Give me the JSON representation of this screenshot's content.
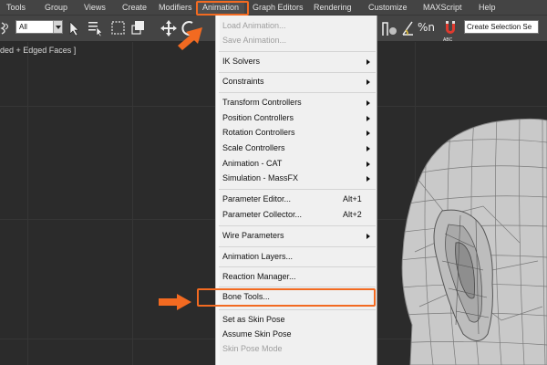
{
  "menubar": {
    "items": [
      {
        "label": "Tools"
      },
      {
        "label": "Group"
      },
      {
        "label": "Views"
      },
      {
        "label": "Create"
      },
      {
        "label": "Modifiers"
      },
      {
        "label": "Animation"
      },
      {
        "label": "Graph Editors"
      },
      {
        "label": "Rendering"
      },
      {
        "label": "Customize"
      },
      {
        "label": "MAXScript"
      },
      {
        "label": "Help"
      }
    ]
  },
  "toolbar": {
    "selection_filter": "All",
    "named_selection_set": "Create Selection Se",
    "spinner_snap_icon_text": "%n",
    "edit_named_sel_icon_text": "ABC"
  },
  "viewport": {
    "label": "ded + Edged Faces ]"
  },
  "animation_menu": {
    "load_animation": "Load Animation...",
    "save_animation": "Save Animation...",
    "ik_solvers": "IK Solvers",
    "constraints": "Constraints",
    "transform_controllers": "Transform Controllers",
    "position_controllers": "Position Controllers",
    "rotation_controllers": "Rotation Controllers",
    "scale_controllers": "Scale Controllers",
    "animation_cat": "Animation - CAT",
    "simulation_massfx": "Simulation - MassFX",
    "parameter_editor": "Parameter Editor...",
    "parameter_editor_shortcut": "Alt+1",
    "parameter_collector": "Parameter Collector...",
    "parameter_collector_shortcut": "Alt+2",
    "wire_parameters": "Wire Parameters",
    "animation_layers": "Animation Layers...",
    "reaction_manager": "Reaction Manager...",
    "bone_tools": "Bone Tools...",
    "set_as_skin_pose": "Set as Skin Pose",
    "assume_skin_pose": "Assume Skin Pose",
    "skin_pose_mode": "Skin Pose Mode"
  },
  "colors": {
    "highlight": "#f26a21",
    "menubar_bg": "#444444",
    "menu_bg": "#f0f0f0",
    "viewport_bg": "#2b2b2b"
  }
}
